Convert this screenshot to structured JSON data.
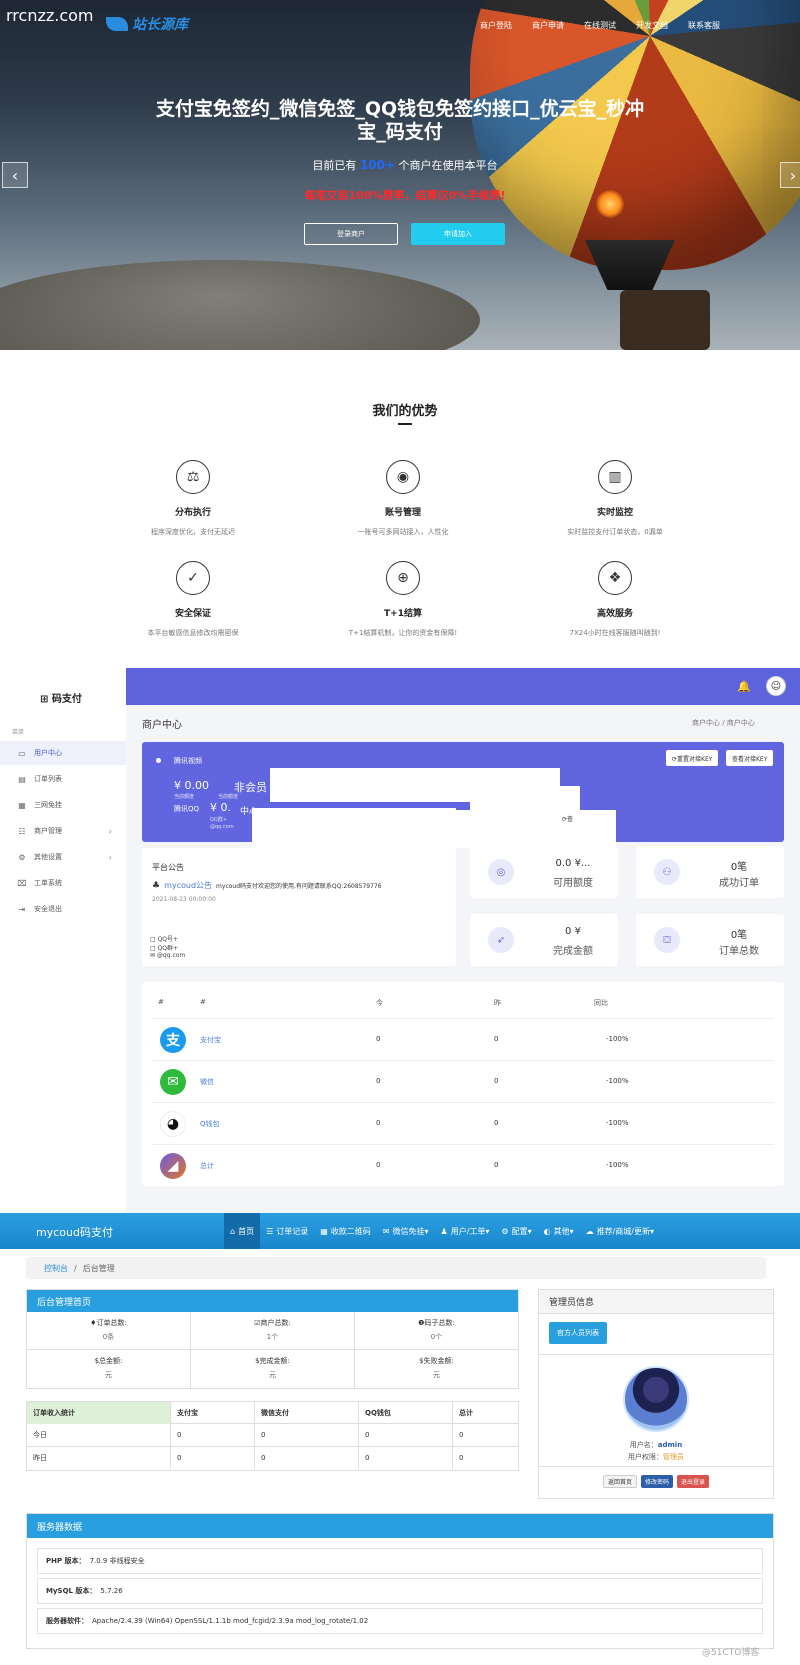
{
  "hero": {
    "watermark": "rrcnzz.com",
    "logo_text": "站长源库",
    "nav": [
      "商户登陆",
      "商户申请",
      "在线测试",
      "开发文档",
      "联系客服"
    ],
    "title": "支付宝免签约_微信免签_QQ钱包免签约接口_优云宝_秒冲宝_码支付",
    "subtitle_pre": "目前已有",
    "subtitle_highlight": "100+",
    "subtitle_post": "个商户在使用本平台",
    "promo": "每笔交易100%费率，结算仅0%手续费!",
    "btn_login": "登录商户",
    "btn_apply": "申请加入",
    "arrow_left": "‹",
    "arrow_right": "›"
  },
  "advantages": {
    "title": "我们的优势",
    "features": [
      {
        "icon": "scale-icon",
        "glyph": "⚖",
        "name": "分布执行",
        "desc": "程序深度优化，支付无延迟"
      },
      {
        "icon": "user-icon",
        "glyph": "◉",
        "name": "账号管理",
        "desc": "一账号可多网站接入，人性化"
      },
      {
        "icon": "chart-icon",
        "glyph": "▥",
        "name": "实时监控",
        "desc": "实时监控支付订单状态，0漏单"
      },
      {
        "icon": "shield-icon",
        "glyph": "✓",
        "name": "安全保证",
        "desc": "本平台敏感信息修改均需密保"
      },
      {
        "icon": "crosshair-icon",
        "glyph": "⊕",
        "name": "T+1结算",
        "desc": "T+1结算机制，让你的资金有保障!"
      },
      {
        "icon": "service-icon",
        "glyph": "❖",
        "name": "高效服务",
        "desc": "7X24小时在线客服随叫随到!"
      }
    ]
  },
  "merchant": {
    "brand": "码支付",
    "menu_caption": "菜单",
    "menu": [
      {
        "icon": "monitor-icon",
        "glyph": "▭",
        "label": "用户中心",
        "arrow": ""
      },
      {
        "icon": "list-icon",
        "glyph": "▤",
        "label": "订单列表",
        "arrow": ""
      },
      {
        "icon": "qr-icon",
        "glyph": "▦",
        "label": "三网免挂",
        "arrow": ""
      },
      {
        "icon": "users-icon",
        "glyph": "☷",
        "label": "商户管理",
        "arrow": "›"
      },
      {
        "icon": "settings-icon",
        "glyph": "⚙",
        "label": "其他设置",
        "arrow": "›"
      },
      {
        "icon": "ticket-icon",
        "glyph": "⌧",
        "label": "工单系统",
        "arrow": ""
      },
      {
        "icon": "logout-icon",
        "glyph": "⇥",
        "label": "安全退出",
        "arrow": ""
      }
    ],
    "page_title": "商户中心",
    "breadcrumb": "商户中心  /  商户中心",
    "banner": {
      "vip_name": "腾讯视频",
      "balance": "¥ 0.00",
      "level": "非会员",
      "small1": "当前额度",
      "small2": "当前额度",
      "qq_label": "腾讯QQ",
      "balance2": "¥ 0.",
      "center": "中心",
      "qq_line": "QQ群+",
      "mail_line": "@qq.com",
      "btn_reset": "⟳重置对接KEY",
      "btn_view": "查看对接KEY",
      "side_text": "⟳查"
    },
    "notice": {
      "title": "平台公告",
      "link": "mycoud公告",
      "text": "mycoud码支付欢迎您的使用,有问题请联系QQ:2608579776",
      "date": "2021-08-23 00:00:00",
      "line1": "□ QQ号+",
      "line2": "□ QQ群+",
      "line3": "✉ @qq.com"
    },
    "stats": [
      {
        "icon": "wallet-icon",
        "glyph": "◎",
        "value": "0.0 ¥...",
        "label": "可用额度"
      },
      {
        "icon": "group-icon",
        "glyph": "⚇",
        "value": "0笔",
        "label": "成功订单"
      },
      {
        "icon": "rocket-icon",
        "glyph": "➶",
        "value": "0 ¥",
        "label": "完成金额"
      },
      {
        "icon": "basket-icon",
        "glyph": "⛋",
        "value": "0笔",
        "label": "订单总数"
      }
    ],
    "table": {
      "headers": [
        "#",
        "#",
        "今",
        "昨",
        "同比"
      ],
      "rows": [
        {
          "name": "支付宝",
          "glyph": "支",
          "color": "#1a9bf0",
          "today": "0",
          "yesterday": "0",
          "ratio": "-100%"
        },
        {
          "name": "微信",
          "glyph": "✉",
          "color": "#2fba3e",
          "today": "0",
          "yesterday": "0",
          "ratio": "-100%"
        },
        {
          "name": "Q钱包",
          "glyph": "◕",
          "color": "#111111",
          "today": "0",
          "yesterday": "0",
          "ratio": "-100%"
        },
        {
          "name": "总计",
          "glyph": "◢",
          "color": "#a85ad8",
          "today": "0",
          "yesterday": "0",
          "ratio": "-100%"
        }
      ]
    }
  },
  "admin": {
    "brand": "mycoud码支付",
    "nav": [
      {
        "icon": "home-icon",
        "glyph": "⌂",
        "label": "首页"
      },
      {
        "icon": "orders-icon",
        "glyph": "☰",
        "label": "订单记录"
      },
      {
        "icon": "qrcode-icon",
        "glyph": "▦",
        "label": "收款二维码"
      },
      {
        "icon": "wechat-icon",
        "glyph": "✉",
        "label": "微信免挂▾"
      },
      {
        "icon": "user-icon",
        "glyph": "♟",
        "label": "用户/工单▾"
      },
      {
        "icon": "config-icon",
        "glyph": "⚙",
        "label": "配置▾"
      },
      {
        "icon": "other-icon",
        "glyph": "◐",
        "label": "其他▾"
      },
      {
        "icon": "cloud-icon",
        "glyph": "☁",
        "label": "推荐/商城/更新▾"
      }
    ],
    "breadcrumb_home": "控制台",
    "breadcrumb_sep": "/",
    "breadcrumb_current": "后台管理",
    "home_title": "后台管理首页",
    "stats": [
      {
        "label": "♦订单总数:",
        "value": "0条"
      },
      {
        "label": "☑商户总数:",
        "value": "1个"
      },
      {
        "label": "❶码子总数:",
        "value": "0个"
      },
      {
        "label": "$总金额:",
        "value": "元"
      },
      {
        "label": "$完成金额:",
        "value": "元"
      },
      {
        "label": "$失败金额:",
        "value": "元"
      }
    ],
    "income": {
      "headers": [
        "订单收入统计",
        "支付宝",
        "微信支付",
        "QQ钱包",
        "总计"
      ],
      "rows": [
        [
          "今日",
          "0",
          "0",
          "0",
          "0"
        ],
        [
          "昨日",
          "0",
          "0",
          "0",
          "0"
        ]
      ]
    },
    "admin_info": {
      "title": "管理员信息",
      "list_btn": "官方人员列表",
      "username_label": "用户名：",
      "username": "admin",
      "role_label": "用户权限：",
      "role": "管理员",
      "btn_home": "返回首页",
      "btn_pwd": "修改密码",
      "btn_logout": "退出登录"
    },
    "server": {
      "title": "服务器数据",
      "rows": [
        {
          "label": "PHP 版本：",
          "value": "7.0.9 非线程安全"
        },
        {
          "label": "MySQL 版本：",
          "value": "5.7.26"
        },
        {
          "label": "服务器软件：",
          "value": "Apache/2.4.39 (Win64) OpenSSL/1.1.1b mod_fcgid/2.3.9a mod_log_rotate/1.02"
        }
      ]
    },
    "watermark": "@51CTO博客"
  }
}
